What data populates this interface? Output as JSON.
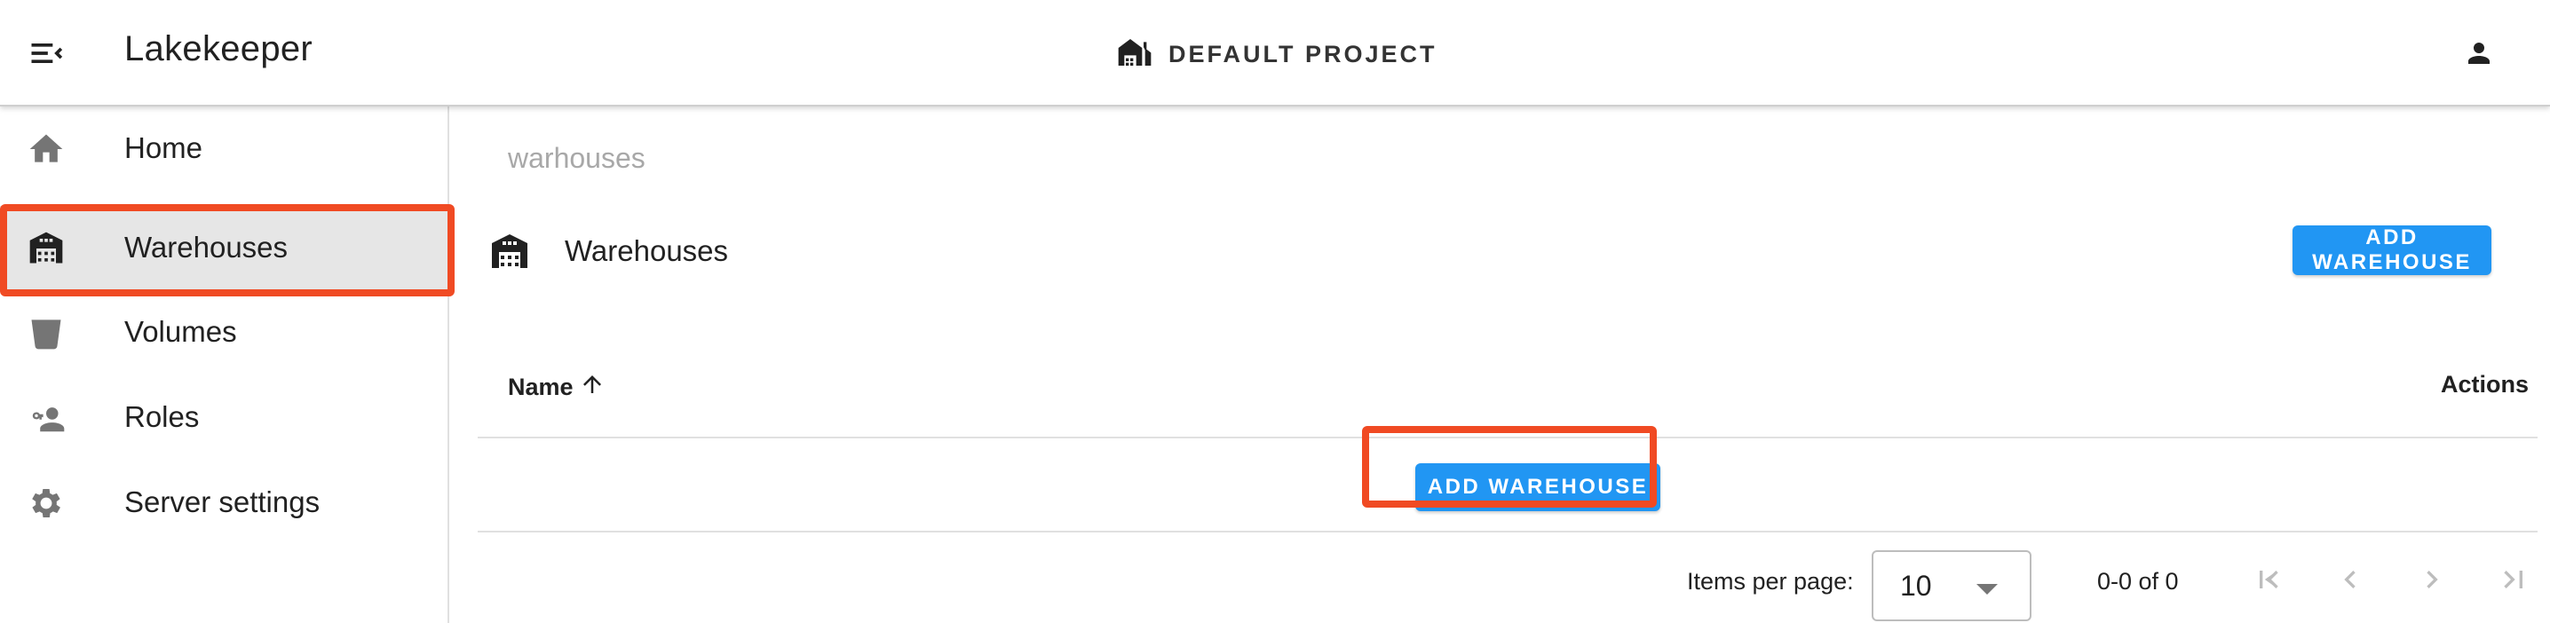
{
  "appbar": {
    "title": "Lakekeeper",
    "project_label": "DEFAULT PROJECT",
    "menu_icon": "menu-collapse-icon",
    "project_icon": "warehouse-home-icon",
    "user_icon": "account-icon"
  },
  "sidebar": {
    "items": [
      {
        "label": "Home",
        "icon": "home-icon"
      },
      {
        "label": "Warehouses",
        "icon": "warehouse-icon",
        "active": true
      },
      {
        "label": "Volumes",
        "icon": "bucket-icon"
      },
      {
        "label": "Roles",
        "icon": "account-key-icon"
      },
      {
        "label": "Server settings",
        "icon": "gear-icon"
      }
    ]
  },
  "main": {
    "breadcrumb": "warhouses",
    "header_title": "Warehouses",
    "add_button_label": "ADD WAREHOUSE",
    "table": {
      "col_name": "Name",
      "col_actions": "Actions",
      "empty_add_label": "ADD WAREHOUSE"
    },
    "pager": {
      "items_per_page_label": "Items per page:",
      "items_per_page_value": "10",
      "range": "0-0 of 0"
    }
  },
  "colors": {
    "accent": "#2196f3",
    "highlight": "#f04a23",
    "active_bg": "#e6e6e6"
  }
}
